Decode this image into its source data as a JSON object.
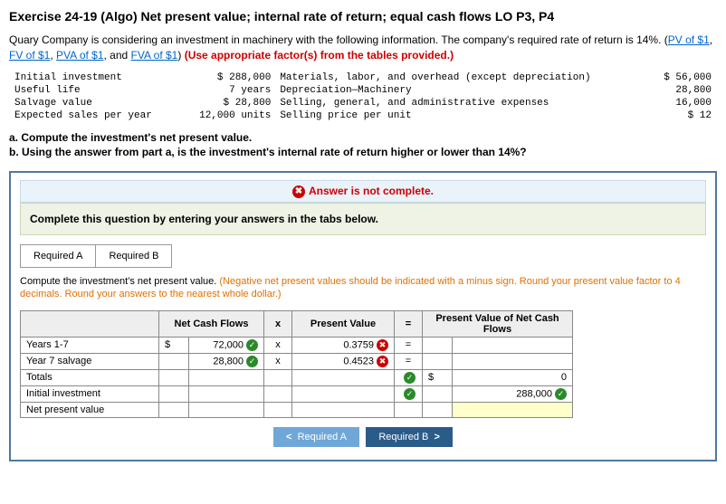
{
  "header": {
    "title": "Exercise 24-19 (Algo) Net present value; internal rate of return; equal cash flows LO P3, P4"
  },
  "intro": {
    "line1a": "Quary Company is considering an investment in machinery with the following information. The company's required rate of return is 14%. (",
    "link1": "PV of $1",
    "sep": ", ",
    "link2": "FV of $1",
    "link3": "PVA of $1",
    "and": ", and ",
    "link4": "FVA of $1",
    "line1b": ") ",
    "use": "(Use appropriate factor(s) from the tables provided.)"
  },
  "given": {
    "r1c1": "Initial investment",
    "r1c2": "$ 288,000",
    "r1c3": "Materials, labor, and overhead (except depreciation)",
    "r1c4": "$ 56,000",
    "r2c1": "Useful life",
    "r2c2": "7 years",
    "r2c3": "Depreciation—Machinery",
    "r2c4": "28,800",
    "r3c1": "Salvage value",
    "r3c2": "$ 28,800",
    "r3c3": "Selling, general, and administrative expenses",
    "r3c4": "16,000",
    "r4c1": "Expected sales per year",
    "r4c2": "12,000 units",
    "r4c3": "Selling price per unit",
    "r4c4": "$ 12"
  },
  "questions": {
    "a": "a. Compute the investment's net present value.",
    "b": "b. Using the answer from part a, is the investment's internal rate of return higher or lower than 14%?"
  },
  "banner": {
    "text": "Answer is not complete."
  },
  "instr": {
    "text": "Complete this question by entering your answers in the tabs below."
  },
  "tabs": {
    "a": "Required A",
    "b": "Required B"
  },
  "subinstr": {
    "black": "Compute the investment's net present value. ",
    "orange": "(Negative net present values should be indicated with a minus sign. Round your present value factor to 4 decimals. Round your answers to the nearest whole dollar.)"
  },
  "calc": {
    "h_ncf": "Net Cash Flows",
    "h_x": "x",
    "h_pv": "Present Value",
    "h_eq": "=",
    "h_pvn": "Present Value of Net Cash Flows",
    "rows": {
      "y17": {
        "label": "Years 1-7",
        "cur": "$",
        "ncf": "72,000",
        "op": "x",
        "pv": "0.3759",
        "eq": "="
      },
      "y7s": {
        "label": "Year 7 salvage",
        "cur": "",
        "ncf": "28,800",
        "op": "x",
        "pv": "0.4523",
        "eq": "="
      },
      "tot": {
        "label": "Totals",
        "cur2": "$",
        "pvn": "0"
      },
      "ini": {
        "label": "Initial investment",
        "pvn": "288,000"
      },
      "npv": {
        "label": "Net present value"
      }
    }
  },
  "nav": {
    "prev": "Required A",
    "next": "Required B"
  }
}
